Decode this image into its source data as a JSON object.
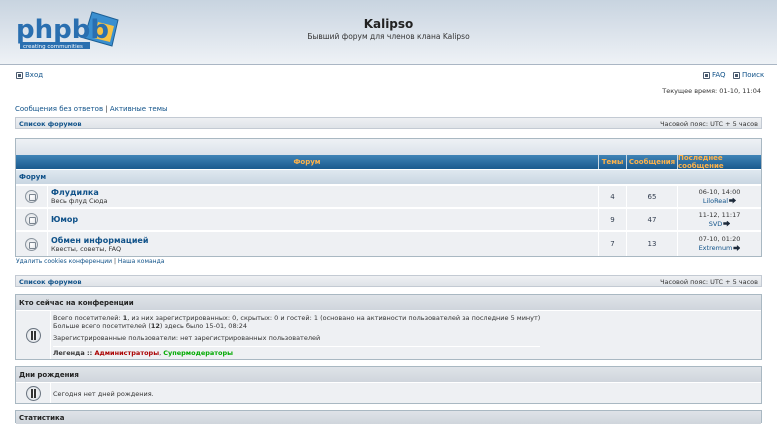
{
  "header": {
    "logo_text": "phpbb",
    "logo_sub": "creating communities",
    "title": "Kalipso",
    "description": "Бывший форум для членов клана Kalipso"
  },
  "nav": {
    "login": "Вход",
    "faq": "FAQ",
    "search": "Поиск",
    "current_time": "Текущее время: 01-10, 11:04",
    "unanswered": "Сообщения без ответов",
    "separator": "|",
    "active": "Активные темы"
  },
  "breadcrumb": {
    "forum_list": "Список форумов",
    "timezone": "Часовой пояс: UTC + 5 часов"
  },
  "table": {
    "columns": [
      "Форум",
      "Темы",
      "Сообщения",
      "Последнее сообщение"
    ],
    "category": "Форум",
    "forums": [
      {
        "name": "Флудилка",
        "desc": "Весь флуд Сюда",
        "topics": "4",
        "posts": "65",
        "last_time": "06-10, 14:00",
        "last_user": "LiloReal"
      },
      {
        "name": "Юмор",
        "desc": "",
        "topics": "9",
        "posts": "47",
        "last_time": "11-12, 11:17",
        "last_user": "SVD"
      },
      {
        "name": "Обмен информацией",
        "desc": "Квесты, советы, FAQ",
        "topics": "7",
        "posts": "13",
        "last_time": "07-10, 01:20",
        "last_user": "Extremum"
      }
    ]
  },
  "footer_links": {
    "delete_cookies": "Удалить cookies конференции",
    "separator": "|",
    "team": "Наша команда"
  },
  "who": {
    "title": "Кто сейчас на конференции",
    "line1_a": "Всего посетителей: ",
    "line1_total": "1",
    "line1_b": ", из них зарегистрированных: 0, скрытых: 0 и гостей: 1 (основано на активности пользователей за последние 5 минут)",
    "line2_a": "Больше всего посетителей (",
    "line2_max": "12",
    "line2_b": ") здесь было 15-01, 08:24",
    "line3": "Зарегистрированные пользователи: нет зарегистрированных пользователей",
    "legend_label": "Легенда :: ",
    "legend_admin": "Администраторы",
    "legend_comma": ", ",
    "legend_smod": "Супермодераторы"
  },
  "birthdays": {
    "title": "Дни рождения",
    "text": "Сегодня нет дней рождения."
  },
  "stats": {
    "title": "Статистика"
  },
  "colors": {
    "link": "#105289",
    "header_bar": "#1a5a8e",
    "header_text": "#ffb34a",
    "admin": "#AA0000",
    "smod": "#00AA00"
  }
}
